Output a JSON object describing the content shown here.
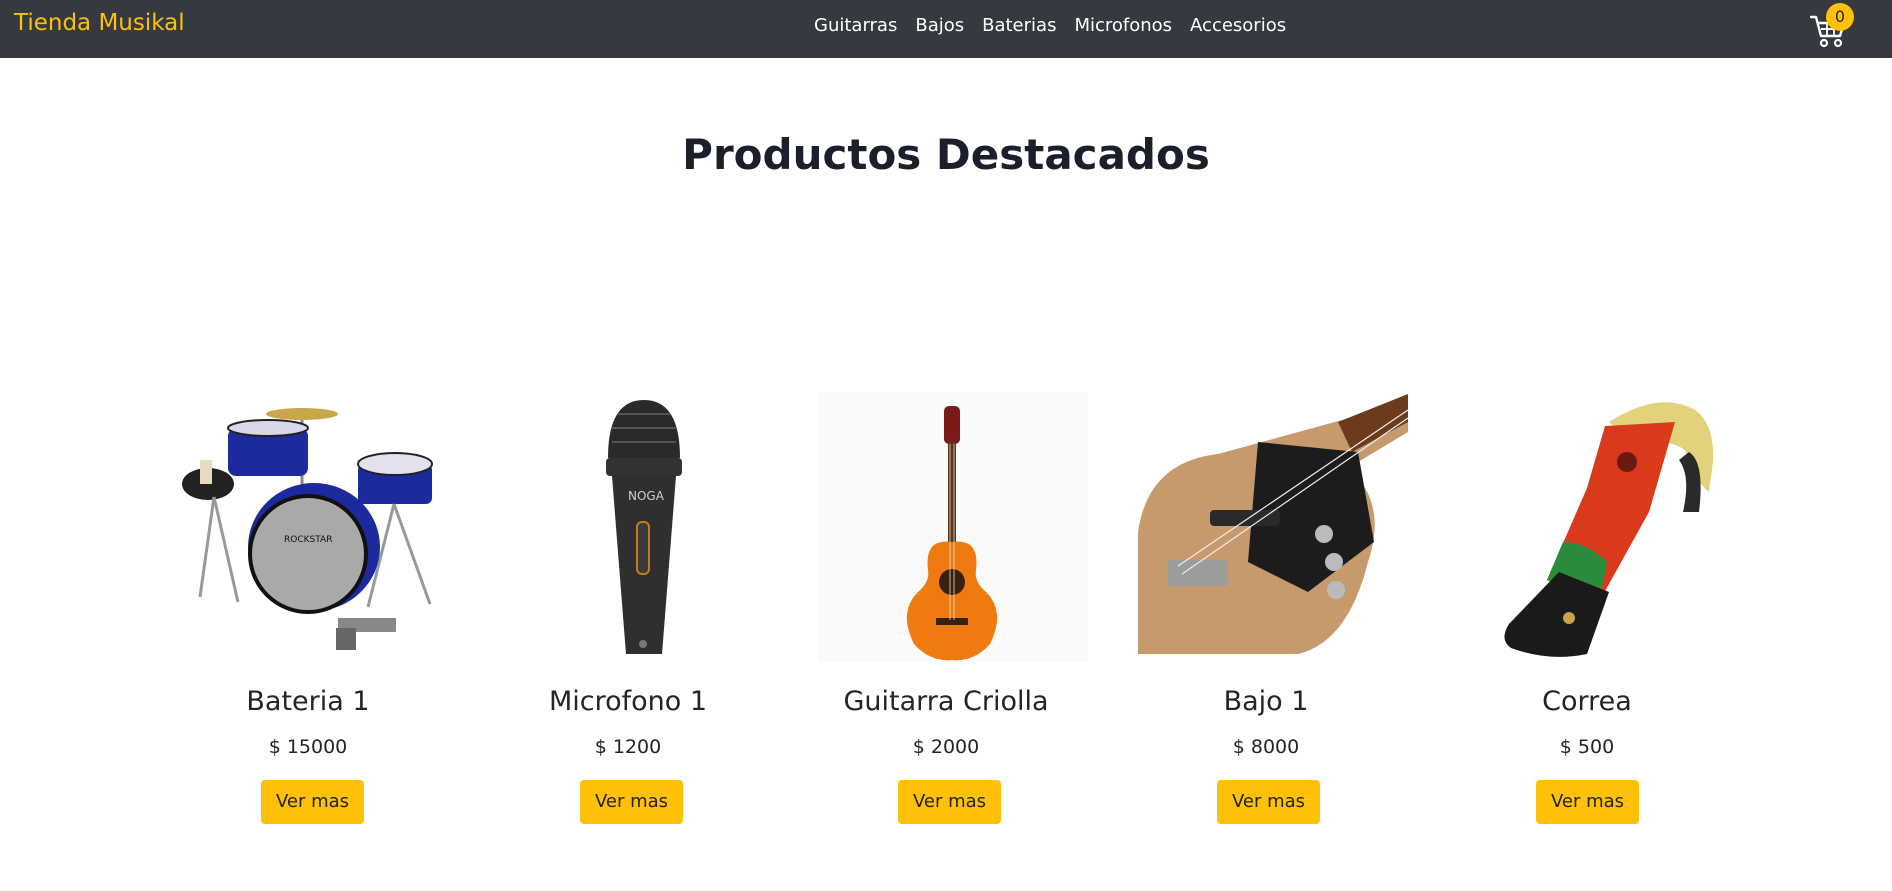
{
  "navbar": {
    "brand": "Tienda Musikal",
    "links": [
      "Guitarras",
      "Bajos",
      "Baterias",
      "Microfonos",
      "Accesorios"
    ],
    "cart_count": "0",
    "cart_icon": "cart-icon",
    "bg_color": "#343a40",
    "accent_color": "#ffc107"
  },
  "main": {
    "title": "Productos Destacados",
    "products": [
      {
        "name": "Bateria 1",
        "price": "$ 15000",
        "button": "Ver mas",
        "image": "drum-kit-image"
      },
      {
        "name": "Microfono 1",
        "price": "$ 1200",
        "button": "Ver mas",
        "image": "microphone-image"
      },
      {
        "name": "Guitarra Criolla",
        "price": "$ 2000",
        "button": "Ver mas",
        "image": "guitar-image"
      },
      {
        "name": "Bajo 1",
        "price": "$ 8000",
        "button": "Ver mas",
        "image": "bass-image"
      },
      {
        "name": "Correa",
        "price": "$ 500",
        "button": "Ver mas",
        "image": "strap-image"
      }
    ]
  }
}
